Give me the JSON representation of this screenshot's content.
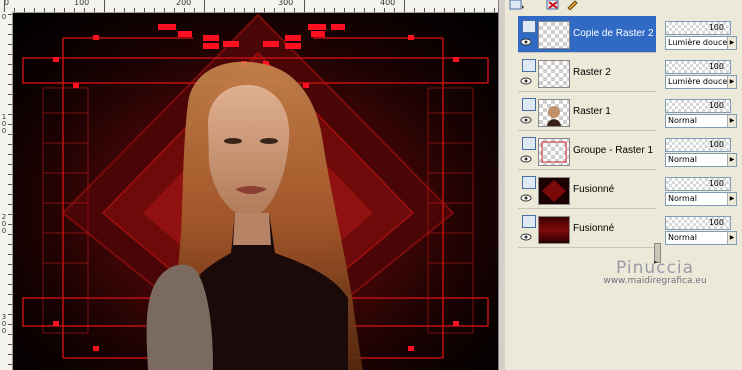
{
  "rulers": {
    "top_labels": [
      "0",
      "100",
      "200",
      "300",
      "400"
    ],
    "left_labels": [
      "0",
      "1\n0\n0",
      "2\n0\n0",
      "3\n0\n0"
    ]
  },
  "toolbar": {
    "icons": [
      "new-layer-icon",
      "delete-layer-icon",
      "edit-icon"
    ]
  },
  "layers": [
    {
      "name": "Copie de Raster 2",
      "selected": true,
      "thumb": "transparent",
      "opacity": "100",
      "blend": "Lumière douce"
    },
    {
      "name": "Raster 2",
      "selected": false,
      "thumb": "transparent",
      "opacity": "100",
      "blend": "Lumière douce"
    },
    {
      "name": "Raster 1",
      "selected": false,
      "thumb": "portrait",
      "opacity": "100",
      "blend": "Normal"
    },
    {
      "name": "Groupe - Raster 1",
      "selected": false,
      "thumb": "frame",
      "opacity": "100",
      "blend": "Normal"
    },
    {
      "name": "Fusionné",
      "selected": false,
      "thumb": "red-diamond",
      "opacity": "100",
      "blend": "Normal"
    },
    {
      "name": "Fusionné",
      "selected": false,
      "thumb": "dark-red",
      "opacity": "100",
      "blend": "Normal"
    }
  ],
  "watermark": {
    "title": "Pinuccia",
    "url": "www.maidiregrafica.eu"
  },
  "colors": {
    "selection": "#316ac5",
    "accent_red": "#e00010",
    "panel_bg": "#ece9d8"
  }
}
